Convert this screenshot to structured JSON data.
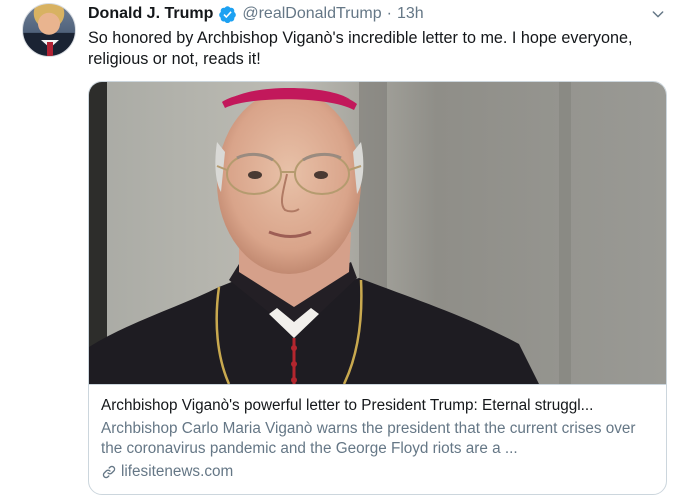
{
  "tweet": {
    "author_name": "Donald J. Trump",
    "author_handle": "@realDonaldTrump",
    "separator": "·",
    "timestamp": "13h",
    "text": "So honored by Archbishop Viganò's incredible letter to me. I hope everyone, religious or not, reads it!"
  },
  "card": {
    "title": "Archbishop Viganò's powerful letter to President Trump: Eternal struggl...",
    "description": "Archbishop Carlo Maria Viganò warns the president that the current crises over the coronavirus pandemic and the George Floyd riots are a ...",
    "domain": "lifesitenews.com",
    "image_subject": "photo-of-archbishop"
  },
  "icons": {
    "verified": "verified-badge-icon",
    "caret": "chevron-down-icon",
    "link": "link-icon"
  },
  "colors": {
    "text_primary": "#14171a",
    "text_secondary": "#657786",
    "verified_blue": "#1da1f2",
    "border": "#ccd6dd"
  }
}
